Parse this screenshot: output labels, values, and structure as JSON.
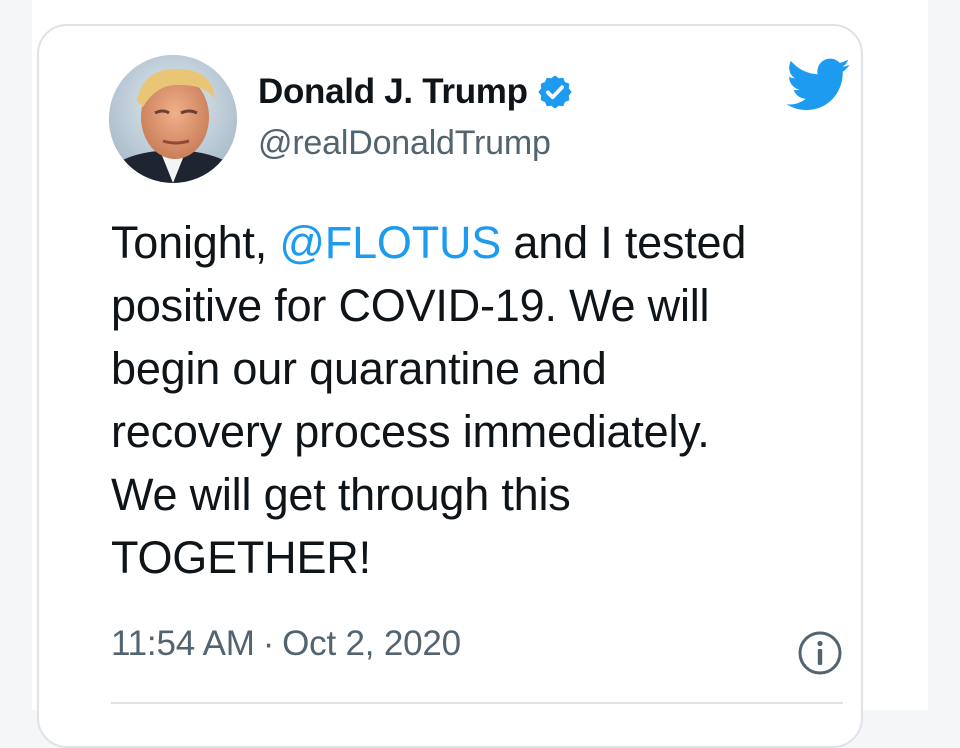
{
  "author": {
    "display_name": "Donald J. Trump",
    "handle": "@realDonaldTrump",
    "verified": true,
    "avatar_icon": "profile-photo"
  },
  "tweet": {
    "segments": {
      "line1_pre": "Tonight, ",
      "mention": "@FLOTUS",
      "line1_post": " and I tested",
      "line2": "positive for COVID-19. We will",
      "line3": "begin our quarantine and",
      "line4": "recovery process immediately.",
      "line5": "We will get through this",
      "line6": "TOGETHER!"
    }
  },
  "meta": {
    "time": "11:54 AM",
    "separator": "·",
    "date": "Oct 2, 2020"
  },
  "icons": {
    "brand": "twitter-bird-icon",
    "verified": "verified-badge-icon",
    "info": "info-icon"
  },
  "colors": {
    "brand_blue": "#1d9bf0",
    "text_primary": "#0f1419",
    "text_secondary": "#536471",
    "border": "#dfe3e8"
  }
}
